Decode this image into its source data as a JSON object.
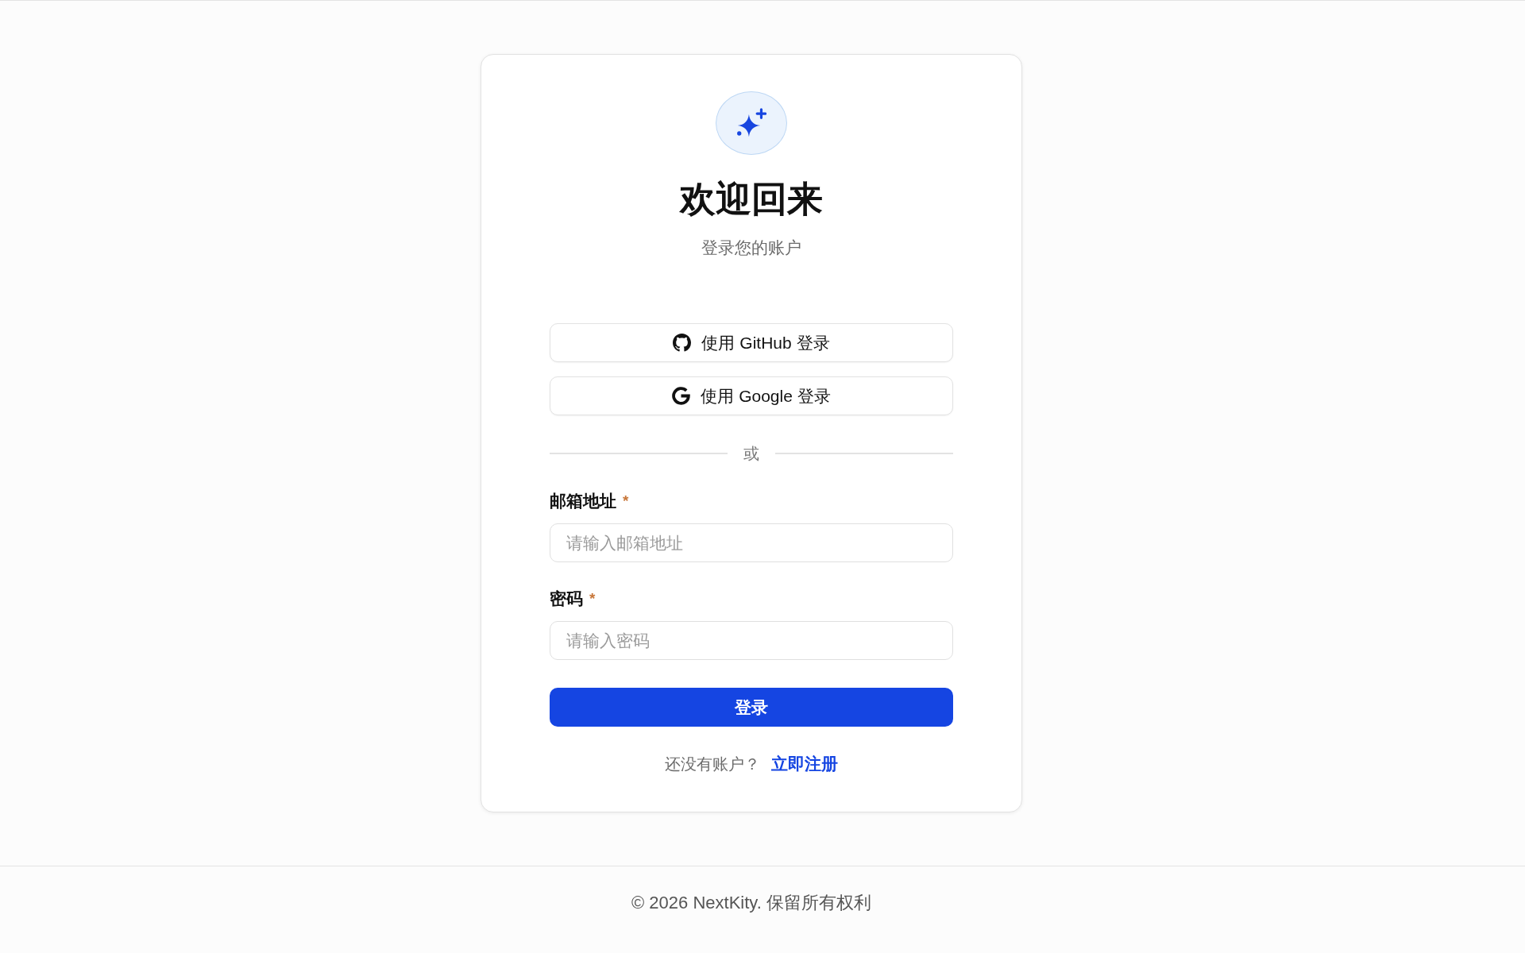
{
  "header": {
    "title": "欢迎回来",
    "subtitle": "登录您的账户"
  },
  "social_buttons": [
    {
      "kind": "github",
      "label": "使用 GitHub 登录"
    },
    {
      "kind": "google",
      "label": "使用 Google 登录"
    }
  ],
  "divider": {
    "label": "或"
  },
  "fields": [
    {
      "label": "邮箱地址",
      "required_mark": "*",
      "placeholder": "请输入邮箱地址"
    },
    {
      "label": "密码",
      "required_mark": "*",
      "placeholder": "请输入密码"
    }
  ],
  "submit_button": {
    "label": "登录"
  },
  "register_prompt": {
    "text": "还没有账户？",
    "link": "立即注册"
  },
  "footer": {
    "text": "© 2026 NextKity. 保留所有权利"
  }
}
